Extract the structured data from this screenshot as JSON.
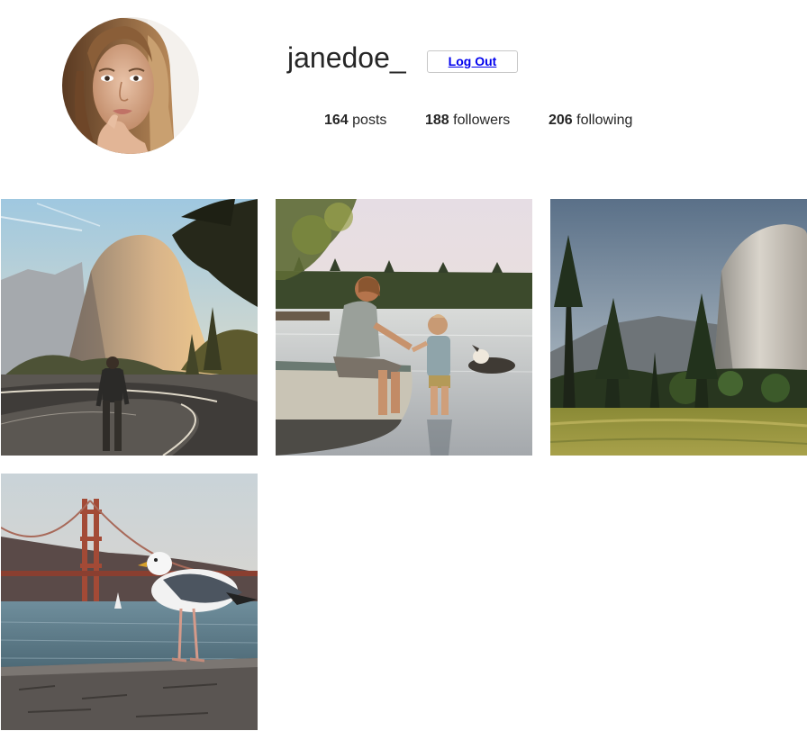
{
  "profile": {
    "username": "janedoe_",
    "logout_label": "Log Out",
    "stats": {
      "posts_count": "164",
      "posts_label": "posts",
      "followers_count": "188",
      "followers_label": "followers",
      "following_count": "206",
      "following_label": "following"
    }
  },
  "posts": [
    {
      "subject": "half-dome-road-walker"
    },
    {
      "subject": "mother-child-lake-dog"
    },
    {
      "subject": "el-capitan-meadow"
    },
    {
      "subject": "seagull-golden-gate-bridge"
    }
  ],
  "colors": {
    "text": "#262626",
    "link": "#0000ee",
    "button_border": "#c7c7c7",
    "background": "#ffffff"
  }
}
